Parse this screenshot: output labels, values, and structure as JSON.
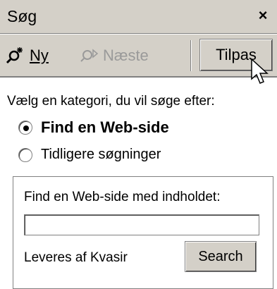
{
  "panel": {
    "title": "Søg",
    "close_label": "×"
  },
  "toolbar": {
    "new_label": "Ny",
    "next_label": "Næste",
    "customize_label": "Tilpas"
  },
  "content": {
    "prompt": "Vælg en kategori, du vil søge efter:",
    "options": [
      {
        "label": "Find en Web-side",
        "selected": true
      },
      {
        "label": "Tidligere søgninger",
        "selected": false
      }
    ]
  },
  "search_box": {
    "label": "Find en Web-side med indholdet:",
    "value": "",
    "provider": "Leveres af Kvasir",
    "button_label": "Search"
  }
}
